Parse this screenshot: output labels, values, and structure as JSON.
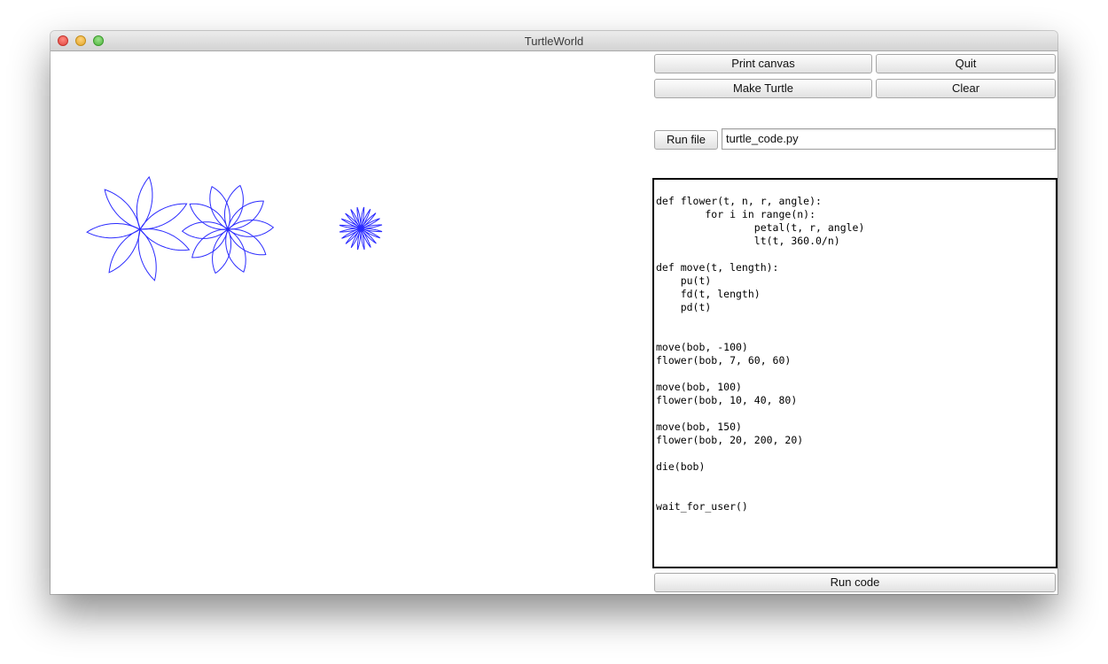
{
  "window": {
    "title": "TurtleWorld"
  },
  "toolbar": {
    "print_canvas": "Print canvas",
    "quit": "Quit",
    "make_turtle": "Make Turtle",
    "clear": "Clear",
    "run_file": "Run file",
    "filename": "turtle_code.py",
    "run_code": "Run code"
  },
  "code": {
    "text": "def flower(t, n, r, angle):\n        for i in range(n):\n                petal(t, r, angle)\n                lt(t, 360.0/n)\n\ndef move(t, length):\n    pu(t)\n    fd(t, length)\n    pd(t)\n\n\nmove(bob, -100)\nflower(bob, 7, 60, 60)\n\nmove(bob, 100)\nflower(bob, 10, 40, 80)\n\nmove(bob, 150)\nflower(bob, 20, 200, 20)\n\ndie(bob)\n\n\nwait_for_user()"
  },
  "canvas": {
    "pen_color": "#2b2bff",
    "flowers": [
      {
        "n": 7,
        "r": 60,
        "angle": 60
      },
      {
        "n": 10,
        "r": 40,
        "angle": 80
      },
      {
        "n": 20,
        "r": 200,
        "angle": 20
      }
    ]
  }
}
